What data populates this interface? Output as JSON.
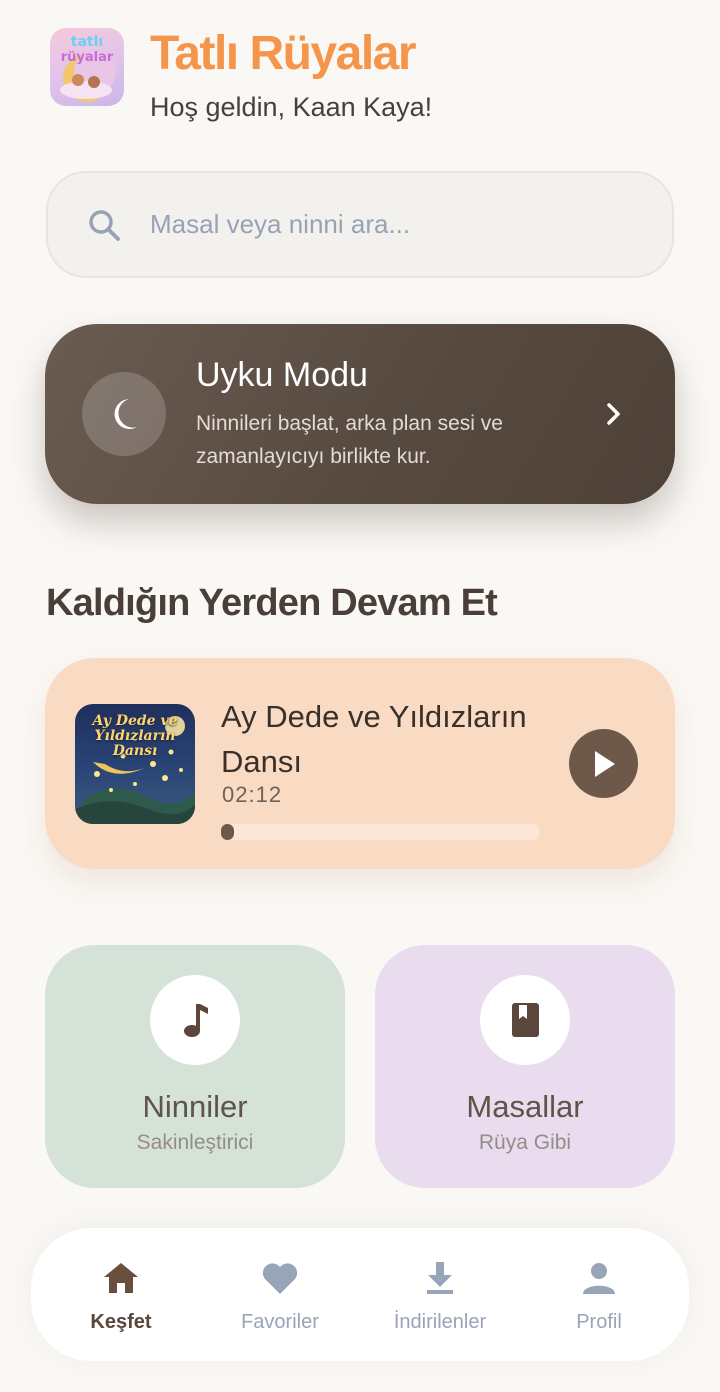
{
  "header": {
    "app_title": "Tatlı Rüyalar",
    "greeting": "Hoş geldin, Kaan Kaya!",
    "logo_icon": "moon-with-sleeping-children-logo"
  },
  "search": {
    "placeholder": "Masal veya ninni ara...",
    "value": "",
    "icon": "search-icon"
  },
  "sleep_mode": {
    "title": "Uyku Modu",
    "description": "Ninnileri başlat, arka plan sesi ve zamanlayıcıyı birlikte kur.",
    "icon": "moon-icon",
    "action_icon": "chevron-right-icon"
  },
  "continue_section": {
    "title": "Kaldığın Yerden Devam Et",
    "track": {
      "title": "Ay Dede ve Yıldızların Dansı",
      "cover_title": "Ay Dede ve Yıldızların Dansı",
      "time": "02:12",
      "progress": 0.04
    }
  },
  "categories": [
    {
      "name": "Ninniler",
      "subtitle": "Sakinleştirici",
      "icon": "music-note-icon",
      "color": "#d4e2d8"
    },
    {
      "name": "Masallar",
      "subtitle": "Rüya Gibi",
      "icon": "book-icon",
      "color": "#e8dcee"
    }
  ],
  "nav": {
    "items": [
      {
        "label": "Keşfet",
        "icon": "home-icon",
        "active": true
      },
      {
        "label": "Favoriler",
        "icon": "heart-icon",
        "active": false
      },
      {
        "label": "İndirilenler",
        "icon": "download-icon",
        "active": false
      },
      {
        "label": "Profil",
        "icon": "user-icon",
        "active": false
      }
    ]
  },
  "colors": {
    "accent": "#f4954b",
    "dark_brown": "#6e5849",
    "inactive": "#98a5b8"
  }
}
